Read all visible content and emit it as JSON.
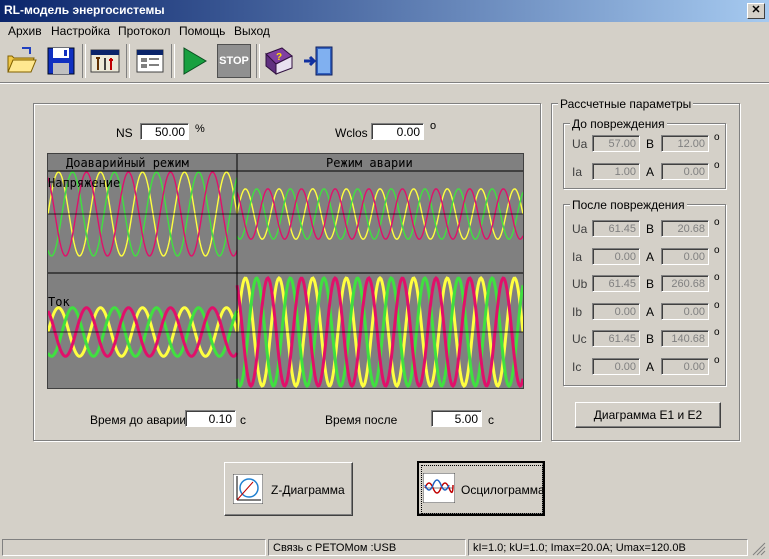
{
  "window": {
    "title": "RL-модель энергосистемы",
    "close_glyph": "✕"
  },
  "menu": [
    "Архив",
    "Настройка",
    "Протокол",
    "Помощь",
    "Выход"
  ],
  "toolbar": {
    "icons": [
      "open-folder-icon",
      "save-disk-icon",
      "tools-icon",
      "window-settings-icon",
      "play-icon",
      "stop-icon",
      "help-book-icon",
      "exit-door-icon"
    ],
    "stop_label": "STOP"
  },
  "params": {
    "ns_label": "NS",
    "ns_value": "50.00",
    "ns_unit": "%",
    "wclos_label": "Wclos",
    "wclos_value": "0.00",
    "wclos_unit": "o"
  },
  "scope": {
    "pre_fault_title": "Доаварийный режим",
    "fault_title": "Режим аварии",
    "voltage_label": "Напряжение",
    "current_label": "Ток",
    "colors": {
      "bg": "#808080",
      "a": "#ffff40",
      "b": "#40e040",
      "c": "#e0106a"
    },
    "waves": {
      "voltage": {
        "pre": {
          "amp": 1.0,
          "periods": 4.5
        },
        "fault": {
          "amp": 0.6,
          "periods": 8.5
        }
      },
      "current": {
        "pre": {
          "amp": 0.45,
          "periods": 4.5
        },
        "fault": {
          "amp": 1.0,
          "periods": 8.5
        }
      }
    }
  },
  "times": {
    "before_label": "Время до аварии",
    "before_value": "0.10",
    "before_unit": "с",
    "after_label": "Время после",
    "after_value": "5.00",
    "after_unit": "с"
  },
  "calc": {
    "title": "Рассчетные параметры",
    "before": {
      "title": "До повреждения",
      "rows": [
        {
          "name": "Ua",
          "mag": "57.00",
          "unit": "В",
          "ang": "12.00",
          "deg": "o"
        },
        {
          "name": "Ia",
          "mag": "1.00",
          "unit": "А",
          "ang": "0.00",
          "deg": "o"
        }
      ]
    },
    "after": {
      "title": "После повреждения",
      "rows": [
        {
          "name": "Ua",
          "mag": "61.45",
          "unit": "В",
          "ang": "20.68",
          "deg": "o"
        },
        {
          "name": "Ia",
          "mag": "0.00",
          "unit": "А",
          "ang": "0.00",
          "deg": "o"
        },
        {
          "name": "Ub",
          "mag": "61.45",
          "unit": "В",
          "ang": "260.68",
          "deg": "o"
        },
        {
          "name": "Ib",
          "mag": "0.00",
          "unit": "А",
          "ang": "0.00",
          "deg": "o"
        },
        {
          "name": "Uc",
          "mag": "61.45",
          "unit": "В",
          "ang": "140.68",
          "deg": "o"
        },
        {
          "name": "Ic",
          "mag": "0.00",
          "unit": "А",
          "ang": "0.00",
          "deg": "o"
        }
      ]
    },
    "diagram_button": "Диаграмма E1 и E2"
  },
  "bottom_buttons": {
    "z_diagram": "Z-Диаграмма",
    "oscillogram": "Осцилограмма"
  },
  "status": {
    "connection": "Связь с РЕТОМом :USB",
    "coefficients": "kI=1.0; kU=1.0; Imax=20.0A; Umax=120.0B"
  }
}
